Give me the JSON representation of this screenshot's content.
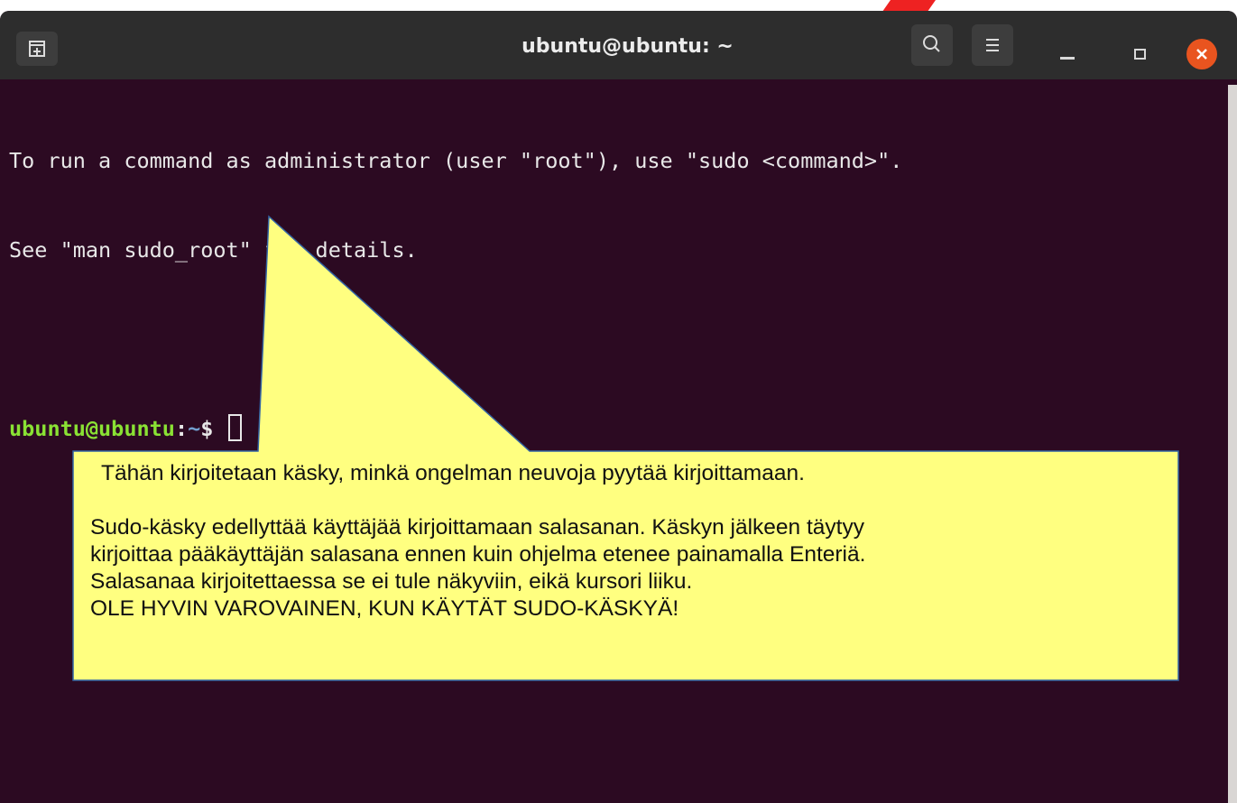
{
  "window": {
    "title": "ubuntu@ubuntu: ~"
  },
  "titlebar": {
    "new_tab_icon": "new-tab-icon",
    "search_icon": "search-icon",
    "menu_icon": "hamburger-menu-icon",
    "minimize_icon": "minimize-icon",
    "maximize_icon": "maximize-icon",
    "close_icon": "close-icon"
  },
  "terminal": {
    "lines": [
      "To run a command as administrator (user \"root\"), use \"sudo <command>\".",
      "See \"man sudo_root\" for details."
    ],
    "prompt": {
      "user": "ubuntu@ubuntu",
      "sep": ":",
      "path": "~",
      "symbol": "$ "
    }
  },
  "callout": {
    "lines": [
      "Tähän kirjoitetaan käsky, minkä ongelman neuvoja pyytää kirjoittamaan.",
      "",
      "Sudo-käsky edellyttää käyttäjää kirjoittamaan salasanan. Käskyn jälkeen täytyy",
      "kirjoittaa pääkäyttäjän salasana ennen kuin ohjelma etenee painamalla Enteriä.",
      "Salasanaa kirjoitettaessa se ei tule näkyviin, eikä kursori liiku.",
      "OLE HYVIN VAROVAINEN, KUN KÄYTÄT SUDO-KÄSKYÄ!"
    ]
  },
  "colors": {
    "terminal_bg": "#2c0a22",
    "titlebar_bg": "#2d2d2d",
    "prompt_user": "#8ae234",
    "prompt_path": "#729fcf",
    "callout_fill": "#ffff80",
    "callout_border": "#3465a4",
    "close_button": "#e9541f",
    "arrow_red": "#ee2222"
  }
}
